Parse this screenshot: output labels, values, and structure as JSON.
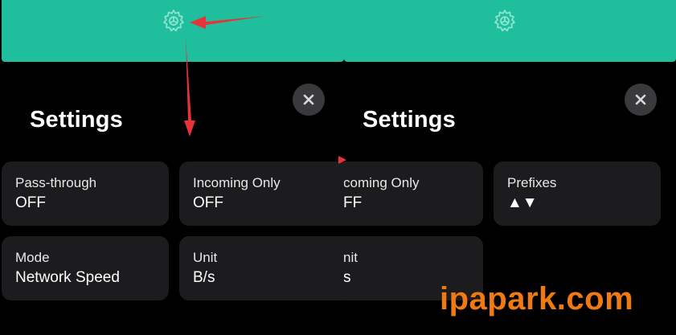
{
  "left": {
    "title": "Settings",
    "cards": [
      {
        "label": "Pass-through",
        "value": "OFF"
      },
      {
        "label": "Incoming Only",
        "value": "OFF"
      },
      {
        "label": "Mode",
        "value": "Network Speed"
      },
      {
        "label": "Unit",
        "value": "B/s"
      }
    ]
  },
  "right": {
    "title": "Settings",
    "cards": [
      {
        "label": "coming Only",
        "value": "FF"
      },
      {
        "label": "Prefixes",
        "value": "▲▼"
      },
      {
        "label": "nit",
        "value": "s"
      }
    ]
  },
  "watermark": "ipapark.com",
  "colors": {
    "header": "#1fbf9d",
    "card": "#1c1c1e",
    "close_button": "#3a3a3c",
    "annotation_arrow": "#e8323a",
    "watermark": "#f07a12"
  },
  "icons": [
    "gear-icon",
    "close-icon",
    "annotation-arrow"
  ]
}
